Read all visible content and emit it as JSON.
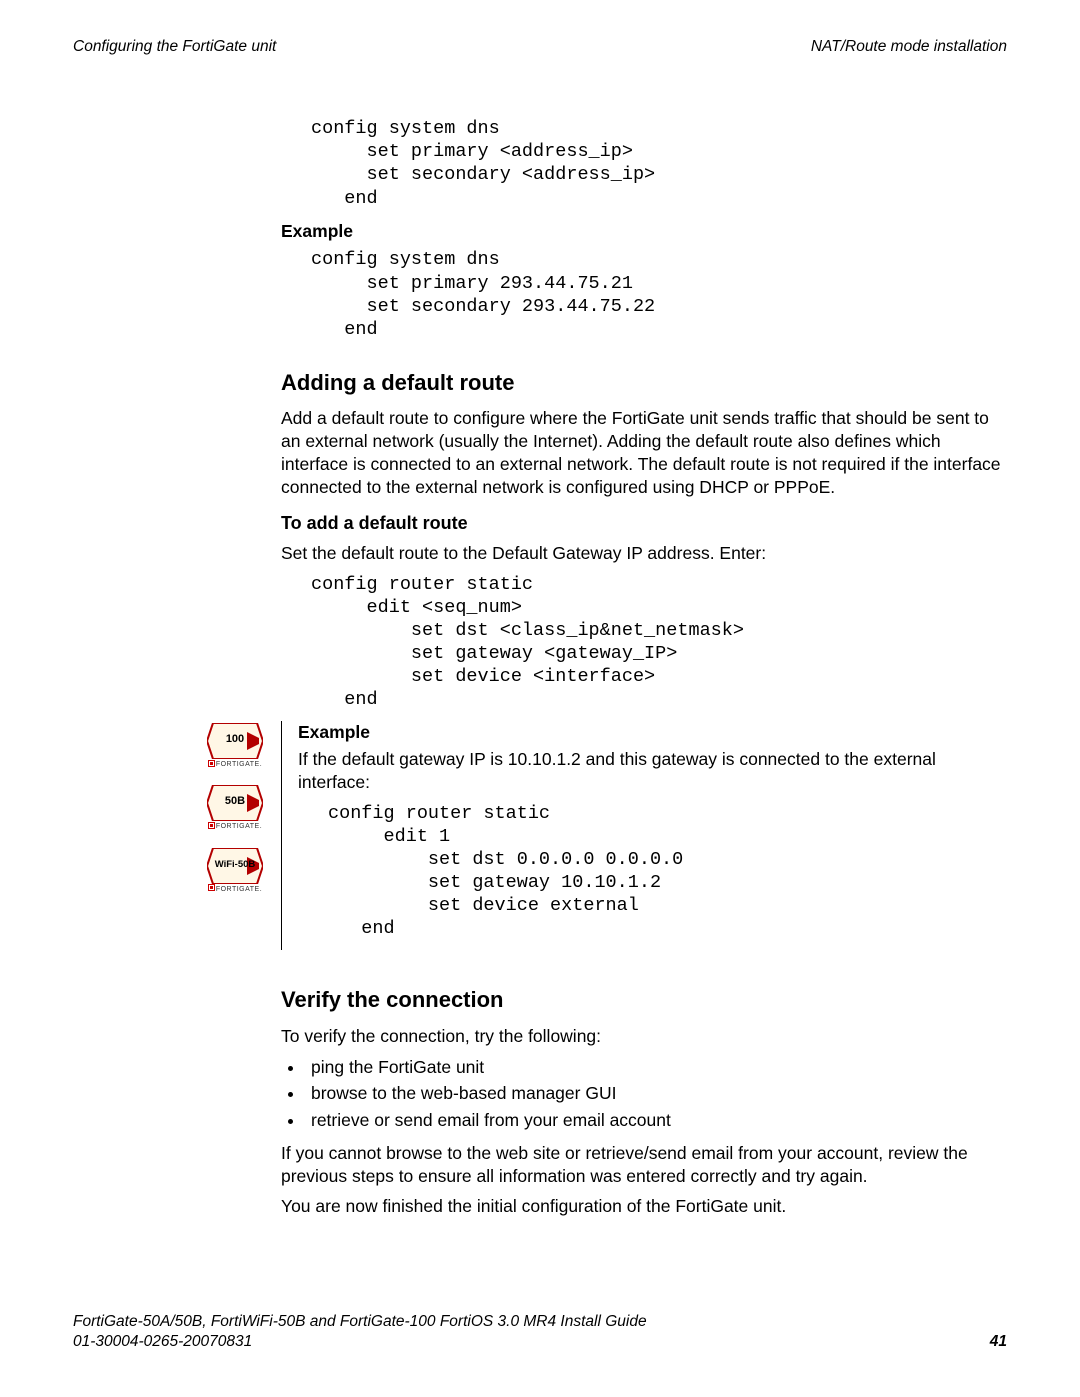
{
  "header": {
    "left": "Configuring the FortiGate unit",
    "right": "NAT/Route mode installation"
  },
  "code_dns_template": "config system dns\n     set primary <address_ip>\n     set secondary <address_ip>\n   end",
  "label_example_1": "Example",
  "code_dns_example": "config system dns\n     set primary 293.44.75.21\n     set secondary 293.44.75.22\n   end",
  "sec_route": {
    "heading": "Adding a default route",
    "para": "Add a default route to configure where the FortiGate unit sends traffic that should be sent to an external network (usually the Internet). Adding the default route also defines which interface is connected to an external network. The default route is not required if the interface connected to the external network is configured using DHCP or PPPoE.",
    "sub": "To add a default route",
    "sub_para": "Set the default route to the Default Gateway IP address. Enter:",
    "code_template": "config router static\n     edit <seq_num>\n         set dst <class_ip&net_netmask>\n         set gateway <gateway_IP>\n         set device <interface>\n   end",
    "label_example_2": "Example",
    "example_para": "If the default gateway IP is 10.10.1.2 and this gateway is connected to the external interface:",
    "code_example": "config router static\n     edit 1\n         set dst 0.0.0.0 0.0.0.0\n         set gateway 10.10.1.2\n         set device external\n   end"
  },
  "devices": [
    {
      "label": "100"
    },
    {
      "label": "50B"
    },
    {
      "label": "WiFi-50B"
    }
  ],
  "brand_text": "FORTIGATE.",
  "sec_verify": {
    "heading": "Verify the connection",
    "intro": "To verify the connection, try the following:",
    "bullets": [
      "ping the FortiGate unit",
      "browse to the web-based manager GUI",
      "retrieve or send email from your email account"
    ],
    "p2": "If you cannot browse to the web site or retrieve/send email from your account, review the previous steps to ensure all information was entered correctly and try again.",
    "p3": "You are now finished the initial configuration of the FortiGate unit."
  },
  "footer": {
    "line1": "FortiGate-50A/50B, FortiWiFi-50B and FortiGate-100 FortiOS 3.0 MR4 Install Guide",
    "line2": "01-30004-0265-20070831",
    "page": "41"
  }
}
